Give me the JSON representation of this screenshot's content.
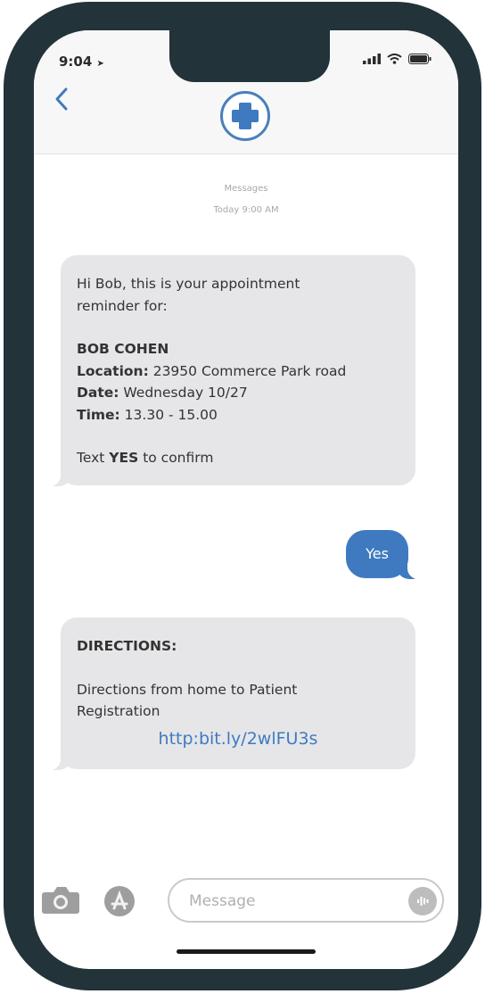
{
  "status": {
    "time": "9:04"
  },
  "header": {
    "contact_icon": "medical-cross-icon",
    "service": "Messages",
    "timestamp": "Today 9:00 AM"
  },
  "messages": {
    "reminder": {
      "greeting": "Hi Bob, this is your appointment reminder for:",
      "name": "BOB COHEN",
      "location_label": "Location:",
      "location_value": " 23950 Commerce Park road",
      "date_label": "Date:",
      "date_value": " Wednesday 10/27",
      "time_label": "Time:",
      "time_value": " 13.30 - 15.00",
      "confirm_prefix": "Text ",
      "confirm_keyword": "YES",
      "confirm_suffix": " to confirm"
    },
    "reply": {
      "text": "Yes"
    },
    "directions": {
      "title": "DIRECTIONS:",
      "body": "Directions from home to Patient Registration",
      "link": "http:bit.ly/2wlFU3s"
    }
  },
  "input": {
    "placeholder": "Message"
  },
  "colors": {
    "accent": "#3f7ac0",
    "frame": "#22333a",
    "bubble": "#e6e6e8"
  }
}
